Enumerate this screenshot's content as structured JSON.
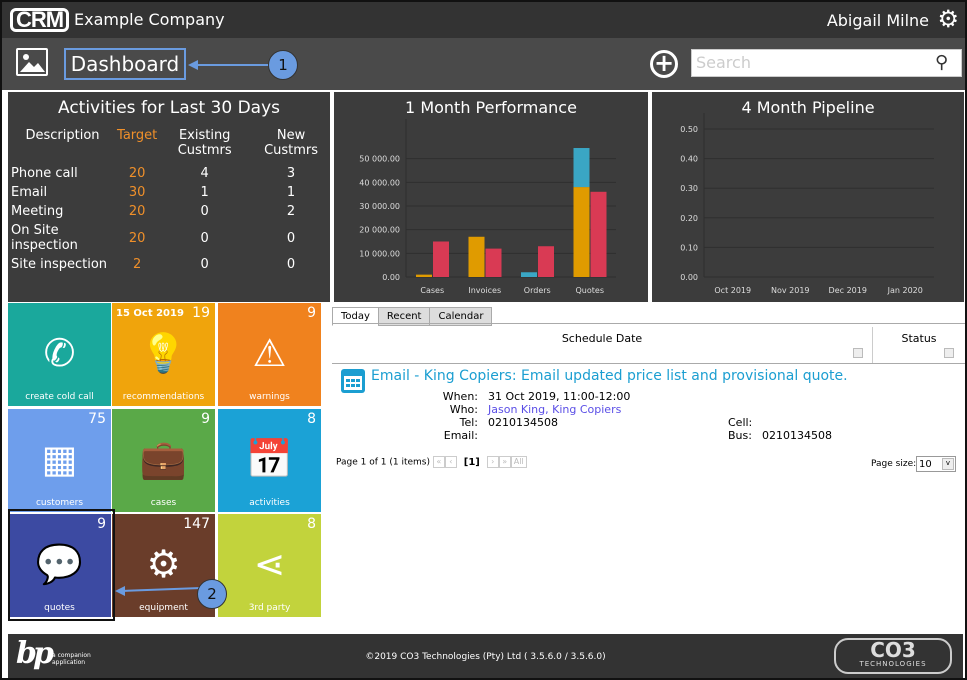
{
  "header": {
    "logo": "CRM",
    "company": "Example Company",
    "user": "Abigail Milne"
  },
  "subbar": {
    "title": "Dashboard",
    "search_placeholder": "Search",
    "callout1": "1",
    "callout2": "2"
  },
  "activities": {
    "title": "Activities for Last 30 Days",
    "headers": [
      "Description",
      "Target",
      "Existing Custmrs",
      "New Custmrs"
    ],
    "rows": [
      [
        "Phone call",
        "20",
        "4",
        "3"
      ],
      [
        "Email",
        "30",
        "1",
        "1"
      ],
      [
        "Meeting",
        "20",
        "0",
        "2"
      ],
      [
        "On Site inspection",
        "20",
        "0",
        "0"
      ],
      [
        "Site inspection",
        "2",
        "0",
        "0"
      ]
    ]
  },
  "chart_data": [
    {
      "type": "bar",
      "title": "1 Month Performance",
      "categories": [
        "Cases",
        "Invoices",
        "Orders",
        "Quotes"
      ],
      "ylim": [
        0,
        60000
      ],
      "yticks": [
        "0.00",
        "10 000.00",
        "20 000.00",
        "30 000.00",
        "40 000.00",
        "50 000.00"
      ],
      "series": [
        {
          "name": "orange",
          "color": "#e09b00",
          "values": [
            1000,
            17000,
            0,
            38000
          ]
        },
        {
          "name": "blue",
          "color": "#3aa6c4",
          "values": [
            0,
            0,
            2000,
            16500
          ],
          "stack_on": "orange"
        },
        {
          "name": "red",
          "color": "#d93a54",
          "values": [
            15000,
            12000,
            13000,
            36000
          ]
        }
      ]
    },
    {
      "type": "line",
      "title": "4 Month Pipeline",
      "categories": [
        "Oct 2019",
        "Nov 2019",
        "Dec 2019",
        "Jan 2020"
      ],
      "ylim": [
        0,
        0.5
      ],
      "yticks": [
        "0.00",
        "0.10",
        "0.20",
        "0.30",
        "0.40",
        "0.50"
      ],
      "series": []
    }
  ],
  "tiles": [
    {
      "label": "create cold call",
      "count": "",
      "date": "",
      "color": "#1aa89c",
      "icon": "phone-icon",
      "glyph": "✆"
    },
    {
      "label": "recommendations",
      "count": "19",
      "date": "15 Oct 2019",
      "color": "#f0a40c",
      "icon": "lightbulb-icon",
      "glyph": "💡"
    },
    {
      "label": "warnings",
      "count": "9",
      "date": "",
      "color": "#f0821e",
      "icon": "warning-icon",
      "glyph": "⚠"
    },
    {
      "label": "customers",
      "count": "75",
      "date": "",
      "color": "#6e9eec",
      "icon": "building-icon",
      "glyph": "▦"
    },
    {
      "label": "cases",
      "count": "9",
      "date": "",
      "color": "#5aa948",
      "icon": "briefcase-icon",
      "glyph": "💼"
    },
    {
      "label": "activities",
      "count": "8",
      "date": "",
      "color": "#1ba2d6",
      "icon": "calendar-icon",
      "glyph": "📅"
    },
    {
      "label": "quotes",
      "count": "9",
      "date": "",
      "color": "#3c4aa2",
      "icon": "chat-bubbles-icon",
      "glyph": "💬"
    },
    {
      "label": "equipment",
      "count": "147",
      "date": "",
      "color": "#6a3d2a",
      "icon": "gears-icon",
      "glyph": "⚙"
    },
    {
      "label": "3rd party",
      "count": "8",
      "date": "",
      "color": "#c2d33c",
      "icon": "share-icon",
      "glyph": "⋖"
    }
  ],
  "schedule": {
    "tabs": [
      "Today",
      "Recent",
      "Calendar"
    ],
    "col1": "Schedule Date",
    "col2": "Status",
    "record": {
      "title": "Email - King Copiers: Email updated price list and provisional quote.",
      "when_label": "When:",
      "when": "31 Oct 2019, 11:00-12:00",
      "who_label": "Who:",
      "who": "Jason King, King Copiers",
      "tel_label": "Tel:",
      "tel": "0210134508",
      "email_label": "Email:",
      "cell_label": "Cell:",
      "bus_label": "Bus:",
      "bus": "0210134508"
    },
    "pager": {
      "info": "Page 1 of 1 (1 items)",
      "current": "[1]",
      "all": "All",
      "page_size_label": "Page size:",
      "page_size": "10"
    }
  },
  "footer": {
    "copyright": "©2019 CO3 Technologies (Pty) Ltd ( 3.5.6.0 / 3.5.6.0)",
    "left_logo": "bp",
    "left_logo_text": "a companion application",
    "right_logo": "CO3",
    "right_logo_sub": "TECHNOLOGIES"
  }
}
